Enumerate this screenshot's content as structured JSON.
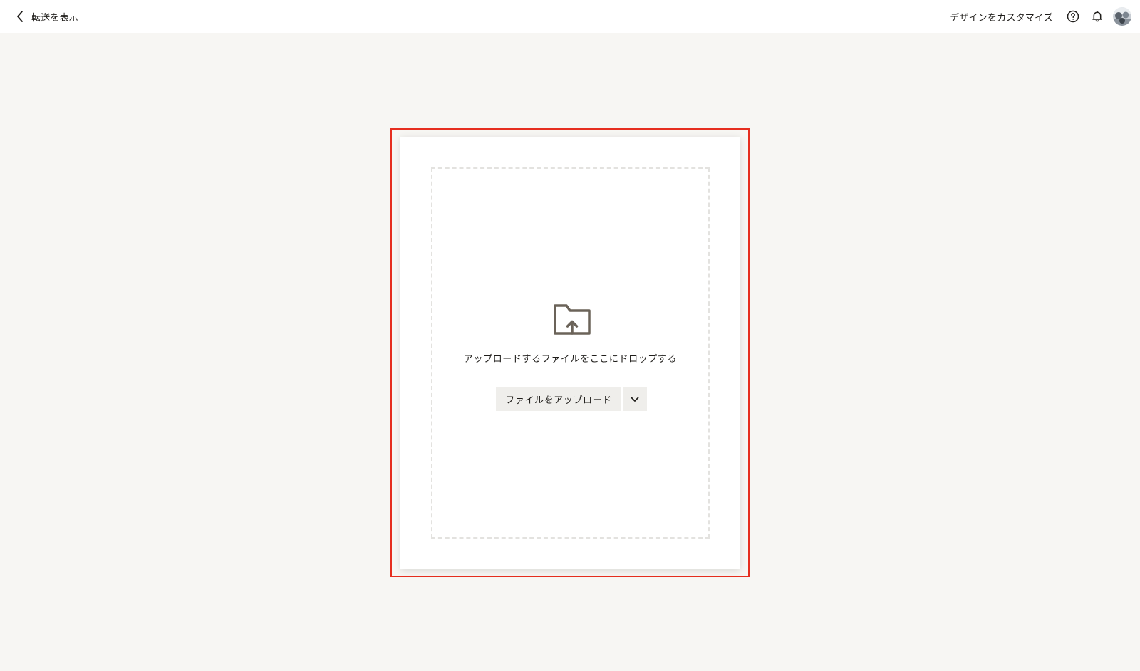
{
  "header": {
    "back_label": "転送を表示",
    "customize_label": "デザインをカスタマイズ",
    "icons": {
      "back": "chevron-left-icon",
      "help": "help-circle-icon",
      "notifications": "bell-icon",
      "avatar": "user-avatar"
    }
  },
  "upload": {
    "icon": "folder-upload-icon",
    "drop_hint": "アップロードするファイルをここにドロップする",
    "upload_button_label": "ファイルをアップロード",
    "menu_icon": "chevron-down-icon"
  },
  "colors": {
    "page_background": "#f7f6f3",
    "card_background": "#ffffff",
    "highlight": "#e62e1f",
    "icon": "#6b6359",
    "button_background": "#efeeeb"
  }
}
